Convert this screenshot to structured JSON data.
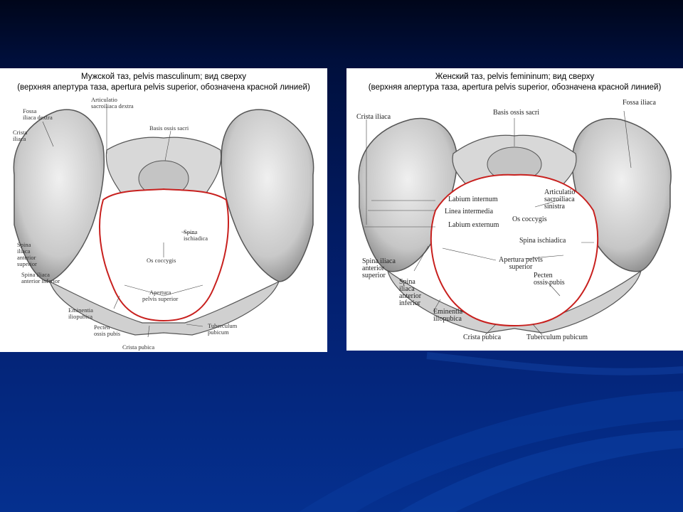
{
  "panels": {
    "male": {
      "title_line1": "Мужской таз, pelvis masculinum; вид сверху",
      "title_line2": "(верхняя апертура таза, apertura pelvis superior, обозначена красной линией)",
      "labels": {
        "fossa_iliaca_dextra": "Fossa\niliaca dextra",
        "crista_iliaca": "Crista\niliaca",
        "articulatio_sacroiliaca_dextra": "Articulatio\nsacroiliaca dextra",
        "basis_ossis_sacri": "Basis ossis sacri",
        "spina_ischiadica": "Spina\nischiadica",
        "spina_iliaca_anterior_superior": "Spina\niliaca\nanterior\nsuperior",
        "spina_iliaca_anterior_inferior": "Spina iliaca\nanterior inferior",
        "os_coccygis": "Os coccygis",
        "apertura_pelvis_superior": "Apertura\npelvis superior",
        "eminentia_iliopubica": "Eminentia\niliopubica",
        "pecten_ossis_pubis": "Pecten\nossis pubis",
        "tuberculum_pubicum": "Tuberculum\npubicum",
        "crista_pubica": "Crista pubica"
      }
    },
    "female": {
      "title_line1": "Женский таз, pelvis femininum; вид сверху",
      "title_line2": "(верхняя апертура таза, apertura pelvis superior, обозначена красной линией)",
      "labels": {
        "crista_iliaca": "Crista iliaca",
        "basis_ossis_sacri": "Basis ossis sacri",
        "fossa_iliaca": "Fossa iliaca",
        "labium_internum": "Labium internum",
        "linea_intermedia": "Linea intermedia",
        "labium_externum": "Labium externum",
        "articulatio_sacroiliaca_sinistra": "Articulatio\nsacroiliaca\nsinistra",
        "os_coccygis": "Os coccygis",
        "spina_ischiadica": "Spina ischiadica",
        "spina_iliaca_anterior_superior": "Spina iliaca\nanterior\nsuperior",
        "apertura_pelvis_superior": "Apertura pelvis\nsuperior",
        "spina_iliaca_anterior_inferior": "Spina\niliaca\nanterior\ninferior",
        "pecten_ossis_pubis": "Pecten\nossis pubis",
        "eminentia_iliopubica": "Eminentia\niliopubica",
        "crista_pubica": "Crista pubica",
        "tuberculum_pubicum": "Tuberculum pubicum"
      }
    }
  },
  "colors": {
    "aperture_line": "#c8201e",
    "bone_light": "#e6e6e6",
    "bone_shadow": "#8a8a8a",
    "background_top": "#00061a",
    "background_bottom": "#05308f"
  }
}
